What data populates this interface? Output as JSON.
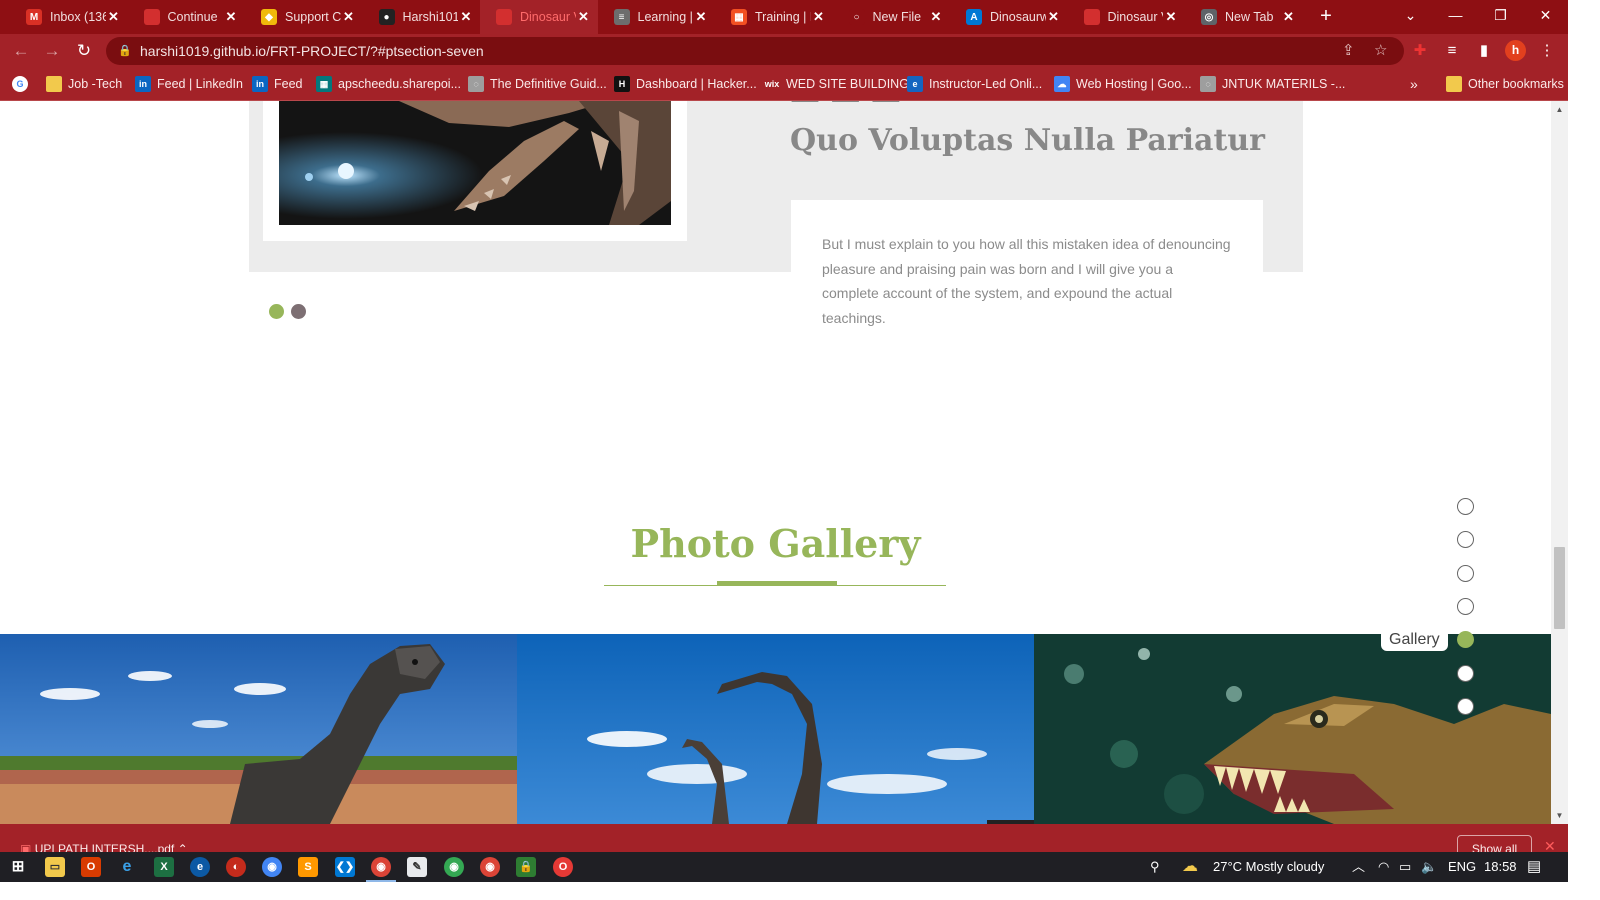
{
  "browser": {
    "tabs": [
      {
        "title": "Inbox (136",
        "icon": "gmail-icon",
        "color": "#d93025",
        "glyph": "M"
      },
      {
        "title": "Continue",
        "icon": "chrome-red-icon",
        "color": "#d32f2f",
        "glyph": ""
      },
      {
        "title": "Support C",
        "icon": "binance-icon",
        "color": "#f0b90b",
        "glyph": "◆"
      },
      {
        "title": "Harshi101",
        "icon": "github-icon",
        "color": "#222222",
        "glyph": "●"
      },
      {
        "title": "Dinosaur V",
        "icon": "dinosaur-site-icon",
        "color": "#d32f2f",
        "glyph": ""
      },
      {
        "title": "Learning |",
        "icon": "document-icon",
        "color": "#6d6d6d",
        "glyph": "≡"
      },
      {
        "title": "Training | M",
        "icon": "microsoft-icon",
        "color": "#f25022",
        "glyph": "▦"
      },
      {
        "title": "New File",
        "icon": "blank-page-icon",
        "color": "#8e0f13",
        "glyph": "○"
      },
      {
        "title": "Dinosaurw",
        "icon": "azure-icon",
        "color": "#0078d4",
        "glyph": "A"
      },
      {
        "title": "Dinosaur V",
        "icon": "dinosaur-site-icon",
        "color": "#d32f2f",
        "glyph": ""
      },
      {
        "title": "New Tab",
        "icon": "chrome-icon",
        "color": "#5f6368",
        "glyph": "◎"
      }
    ],
    "active_tab_index": 4,
    "new_tab_label": "+",
    "url": "harshi1019.github.io/FRT-PROJECT/?#ptsection-seven",
    "bookmarks": [
      {
        "label": "",
        "icon": "google-icon",
        "color": "#ffffff",
        "glyph": "G"
      },
      {
        "label": "Job -Tech",
        "icon": "folder-icon",
        "color": "#f2c94c",
        "glyph": ""
      },
      {
        "label": "Feed | LinkedIn",
        "icon": "linkedin-icon",
        "color": "#0a66c2",
        "glyph": "in"
      },
      {
        "label": "Feed",
        "icon": "linkedin-icon",
        "color": "#0a66c2",
        "glyph": "in"
      },
      {
        "label": "apscheedu.sharepoi...",
        "icon": "sharepoint-icon",
        "color": "#03787c",
        "glyph": "▦"
      },
      {
        "label": "The Definitive Guid...",
        "icon": "globe-icon",
        "color": "#9e9e9e",
        "glyph": "◌"
      },
      {
        "label": "Dashboard | Hacker...",
        "icon": "hackerrank-icon",
        "color": "#111111",
        "glyph": "H"
      },
      {
        "label": "WED SITE BUILDING",
        "icon": "wix-icon",
        "color": "#a32228",
        "glyph": "wix"
      },
      {
        "label": "Instructor-Led Onli...",
        "icon": "edureka-icon",
        "color": "#1565c0",
        "glyph": "e"
      },
      {
        "label": "Web Hosting | Goo...",
        "icon": "google-cloud-icon",
        "color": "#4285f4",
        "glyph": "☁"
      },
      {
        "label": "JNTUK MATERILS -...",
        "icon": "globe-icon",
        "color": "#9e9e9e",
        "glyph": "◌"
      }
    ],
    "more_bookmarks": "»",
    "other_bookmarks": "Other bookmarks",
    "profile_initial": "h"
  },
  "slide": {
    "title_partial": "Quo Voluptas Nulla Pariatur",
    "body": "But I must explain to you how all this mistaken idea of denouncing pleasure and praising pain was born and I will give you a complete account of the system, and expound the actual teachings.",
    "active_dot_color": "#97b65a",
    "dot_color": "#7d6f73"
  },
  "gallery": {
    "title": "Photo Gallery",
    "accent": "#97b65a",
    "images": [
      {
        "name": "brachiosaurus-statue-image"
      },
      {
        "name": "sauropod-silhouettes-image"
      },
      {
        "name": "trex-head-image"
      }
    ]
  },
  "side_nav": {
    "active_index": 4,
    "tooltip": "Gallery",
    "count": 7
  },
  "downloads": {
    "file_name": "UPI PATH INTERSH....pdf",
    "show_all": "Show all",
    "close": "✕"
  },
  "taskbar": {
    "weather": "27°C  Mostly cloudy",
    "language": "ENG",
    "time": "18:58"
  }
}
